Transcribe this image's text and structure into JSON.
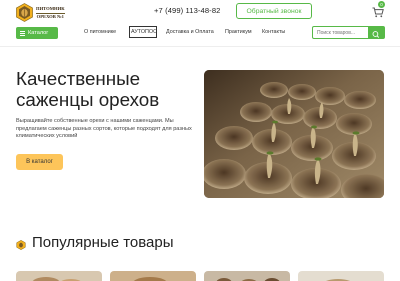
{
  "header": {
    "logo_lines": [
      "ПИТОМНИК",
      "ОРЕХОВ №1"
    ],
    "phone": "+7 (499) 113-48-82",
    "callback_label": "Обратный звонок",
    "cart_count": "0"
  },
  "nav": {
    "catalog_label": "Каталог",
    "items": [
      "О питомнике",
      "АУТОПОС",
      "Доставка и Оплата",
      "Практикум",
      "Контакты"
    ],
    "search_placeholder": "Поиск товаров..."
  },
  "hero": {
    "title_line1": "Качественные",
    "title_line2": "саженцы орехов",
    "description": "Выращивайте собственные орехи с нашими саженцами. Мы предлагаем саженцы разных сортов, которые подходят для разных климатических условий",
    "button_label": "В каталог",
    "image_alt": "seedlings-in-pots-photo"
  },
  "popular": {
    "title": "Популярные товары"
  },
  "colors": {
    "accent_green": "#57b947",
    "button_yellow": "#fdc55a",
    "text_dark": "#222222"
  },
  "icons": [
    "logo-badge-icon",
    "cart-icon",
    "menu-icon",
    "search-icon",
    "nut-icon",
    "heart-icon"
  ]
}
